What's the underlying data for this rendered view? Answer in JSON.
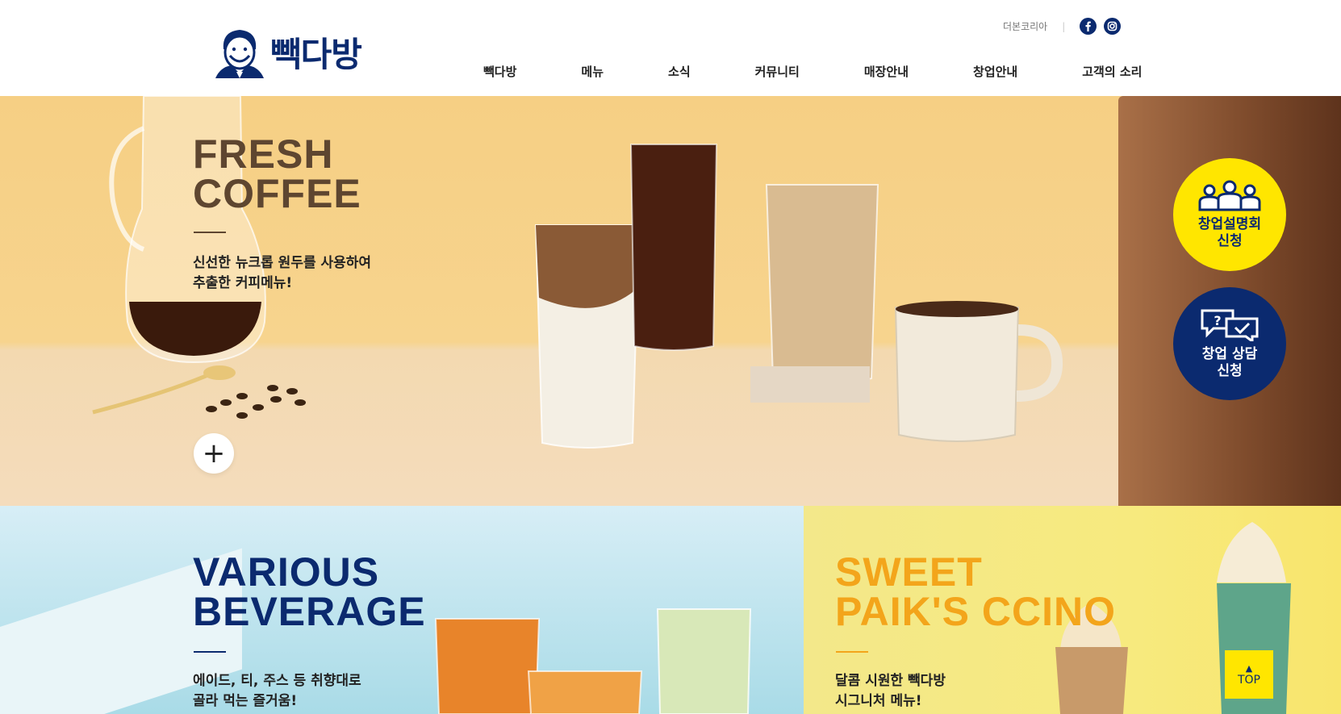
{
  "header": {
    "logo_text": "빽다방",
    "util_link": "더본코리아",
    "util_separator": "|",
    "sns": [
      {
        "icon": "facebook-icon"
      },
      {
        "icon": "instagram-icon"
      }
    ],
    "nav": [
      "빽다방",
      "메뉴",
      "소식",
      "커뮤니티",
      "매장안내",
      "창업안내",
      "고객의 소리"
    ]
  },
  "hero": {
    "title_line1": "FRESH",
    "title_line2": "COFFEE",
    "desc_line1": "신선한 뉴크롭 원두를 사용하여",
    "desc_line2": "추출한 커피메뉴!",
    "more": "+"
  },
  "side_buttons": {
    "seminar_line1": "창업설명회",
    "seminar_line2": "신청",
    "consult_line1": "창업 상담",
    "consult_line2": "신청"
  },
  "beverage": {
    "title_line1": "VARIOUS",
    "title_line2": "BEVERAGE",
    "desc_line1": "에이드, 티, 주스 등 취향대로",
    "desc_line2": "골라 먹는 즐거움!"
  },
  "sweet": {
    "title_line1": "SWEET",
    "title_line2": "PAIK'S CCINO",
    "desc_line1": "달콤 시원한 빽다방",
    "desc_line2": "시그니처 메뉴!"
  },
  "top_button": {
    "arrow": "▲",
    "label": "TOP"
  },
  "colors": {
    "brand_navy": "#0b2a6f",
    "brand_yellow": "#ffe600",
    "sweet_orange": "#f3a51b",
    "coffee_brown": "#5e4630"
  }
}
